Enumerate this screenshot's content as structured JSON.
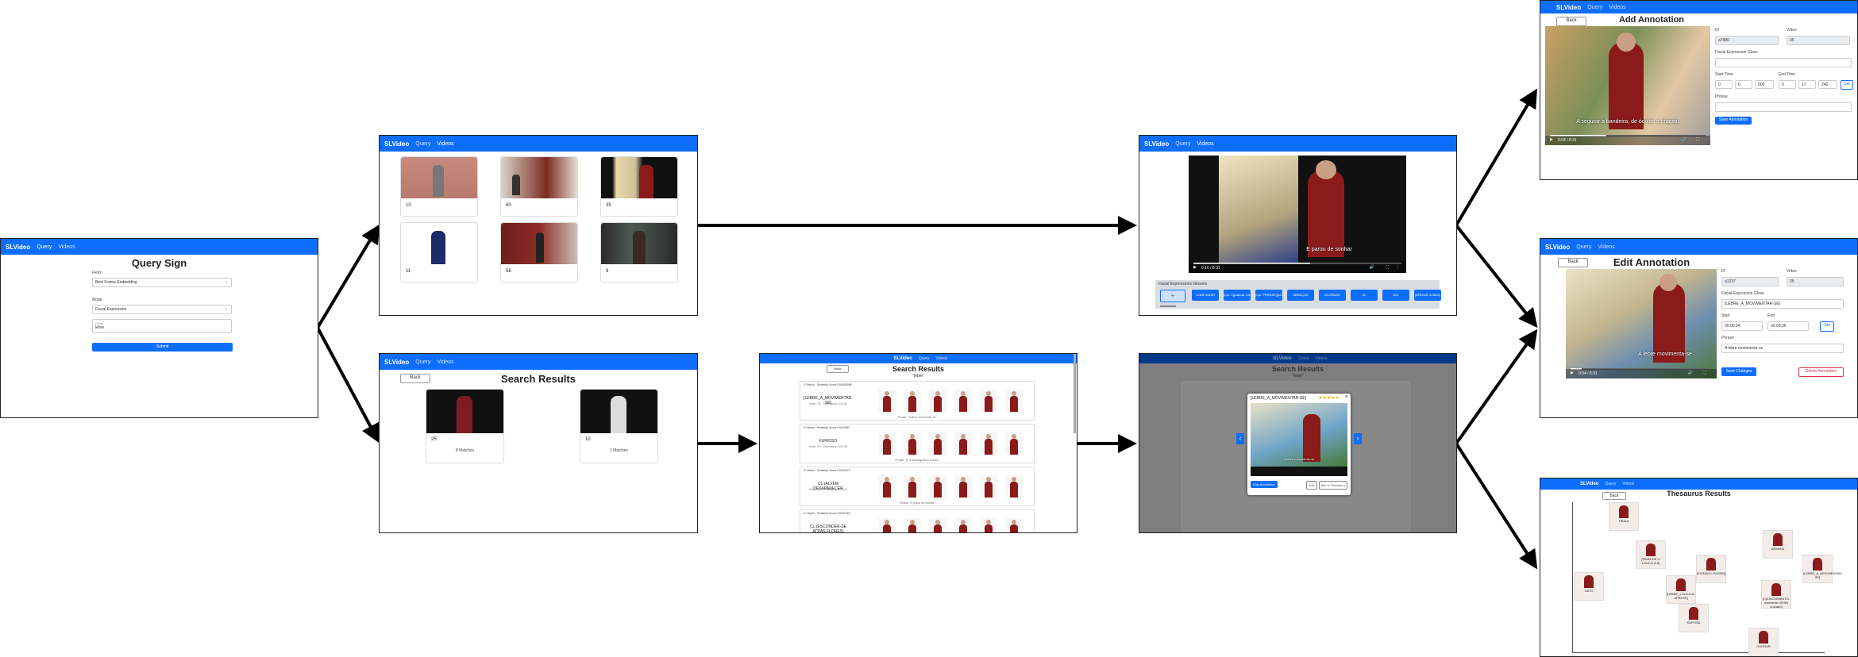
{
  "colors": {
    "primary": "#0d6efd",
    "navbar": "#0d6efd",
    "danger": "#dc3545",
    "arrow": "#000000"
  },
  "nav": {
    "brand": "SLVideo",
    "query": "Query",
    "videos": "Videos"
  },
  "query_sign": {
    "title": "Query Sign",
    "field_label": "Field",
    "field_value": "Best Frame Embedding",
    "mode_label": "Mode",
    "mode_value": "Facial Expression",
    "gloss_label": "Gloss",
    "gloss_value": "lebre",
    "submit": "Submit"
  },
  "videos_grid": {
    "cards": [
      {
        "num": "10"
      },
      {
        "num": "60"
      },
      {
        "num": "35"
      },
      {
        "num": "11"
      },
      {
        "num": "58"
      },
      {
        "num": "9"
      }
    ]
  },
  "search_small": {
    "back": "Back",
    "title": "Search Results",
    "cards": [
      {
        "num": "25",
        "matches": "8 Matches"
      },
      {
        "num": "10",
        "matches": "1 Matches"
      }
    ]
  },
  "search_detail": {
    "back": "Back",
    "title": "Search Results",
    "query": "\"lebre\"",
    "results": [
      {
        "hdr": "1º Match - Similarity Score:0.84605988",
        "gloss": "[LEBRE_A_MOVIMENTAR-SE]",
        "meta": "Video: 25 - Timestamp: 0:00:34",
        "phrase": "Phrase: \"A lebre movimenta-se\""
      },
      {
        "hdr": "2º Match - Similarity Score:0.8433567",
        "gloss": "FURIOSO",
        "meta": "Video: 25 - Timestamp: 0:00:33",
        "phrase": "Phrase: \"E a tartaruga ficou furiosa\""
      },
      {
        "hdr": "3º Match - Similarity Score:0.8403373",
        "gloss": "CL:(ALVEM DESAPARECER",
        "meta": "Video: 25 - Timestamp: 0:00:10",
        "phrase": "Phrase: \"E parou de sonhar\""
      },
      {
        "hdr": "4º Match - Similarity Score:0.8402253",
        "gloss": "CL:(ESCONDER-SE ATRAS FLORES)",
        "meta": "",
        "phrase": ""
      }
    ]
  },
  "video_player": {
    "caption": "E parou de sonhar",
    "time": "0:10 / 8:31",
    "facial_label": "Facial Expressions Glosses",
    "chips": [
      "CONFUNDIR",
      "[Cpl. 1][Lateral, IIA: Antunes, APA]",
      "[Cpl. PHRASE][ALT. 7X]",
      "ABRAÇAR",
      "ACORDAR",
      "AII",
      "AIU",
      "[APAGAR A MAG]"
    ],
    "add": "+"
  },
  "popup": {
    "title": "[LEBRE_A_MOVIMENTAR-SE]",
    "stars": "★★★★★",
    "caption": "A lebre movimenta-se",
    "play": "Play Annotation",
    "edit": "Edit",
    "thesaurus": "See in Thesaurus",
    "prev": "‹",
    "next": "›"
  },
  "add_annotation": {
    "back": "Back",
    "title": "Add Annotation",
    "caption": "A segurar a bandeira, de óculos e chapéu",
    "time": "0:04 / 8:31",
    "id_label": "ID",
    "id_value": "a7880",
    "video_label": "Video",
    "video_value": "35",
    "gloss_label": "Facial Expression Gloss",
    "start_label": "Start Time",
    "start": [
      "0",
      "0",
      "000"
    ],
    "end_label": "End Time",
    "end": [
      "0",
      "17",
      "240"
    ],
    "phrase_label": "Phrase",
    "set": "Set",
    "save": "Save Annotation"
  },
  "edit_annotation": {
    "back": "Back",
    "title": "Edit Annotation",
    "caption": "A lebre movimenta-se",
    "time": "0:34 / 8:31",
    "id_label": "ID",
    "id_value": "a1237",
    "video_label": "Video",
    "video_value": "25",
    "gloss_label": "Facial Expression Gloss",
    "gloss_value": "[LEBRE_A_MOVIMENTAR-SE]",
    "start_label": "Start",
    "start_value": "00:00:34",
    "end_label": "End",
    "end_value": "00:00:36",
    "phrase_label": "Phrase",
    "phrase_value": "A lebre movimenta-se",
    "set": "Set",
    "save": "Save Changes",
    "delete": "Delete Annotation"
  },
  "thesaurus": {
    "back": "Back",
    "title": "Thesaurus Results",
    "nodes": [
      {
        "label": "PRAIA"
      },
      {
        "label": "ARANHA"
      },
      {
        "label": "[PAISA DE O LOUCO A S]"
      },
      {
        "label": "[CISNE(CL:RATAR)]"
      },
      {
        "label": "[LEBRE_A_MOVIMENTAR-SE]"
      },
      {
        "label": "GATO"
      },
      {
        "label": "[LEBRE_LOUCO-A-APRESS]"
      },
      {
        "label": "[Cpl.MOVIMENTO-Ambiente-GRAN cruzado]"
      },
      {
        "label": "RAPOSA"
      },
      {
        "label": "CHORAR"
      }
    ]
  }
}
